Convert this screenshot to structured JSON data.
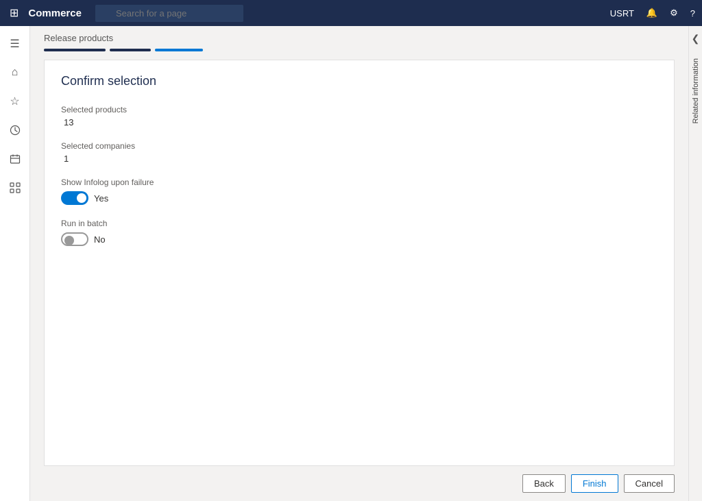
{
  "topbar": {
    "app_title": "Commerce",
    "search_placeholder": "Search for a page",
    "user_label": "USRT"
  },
  "sidebar": {
    "icons": [
      {
        "name": "hamburger-icon",
        "glyph": "☰"
      },
      {
        "name": "home-icon",
        "glyph": "⌂"
      },
      {
        "name": "favorites-icon",
        "glyph": "★"
      },
      {
        "name": "recent-icon",
        "glyph": "🕐"
      },
      {
        "name": "calendar-icon",
        "glyph": "📅"
      },
      {
        "name": "modules-icon",
        "glyph": "⊞"
      }
    ]
  },
  "page": {
    "breadcrumb": "Release products",
    "wizard_title": "Confirm selection",
    "steps": [
      {
        "type": "completed"
      },
      {
        "type": "completed"
      },
      {
        "type": "active"
      }
    ],
    "fields": {
      "selected_products_label": "Selected products",
      "selected_products_value": "13",
      "selected_companies_label": "Selected companies",
      "selected_companies_value": "1",
      "show_infolog_label": "Show Infolog upon failure",
      "show_infolog_value": true,
      "show_infolog_text": "Yes",
      "run_in_batch_label": "Run in batch",
      "run_in_batch_value": false,
      "run_in_batch_text": "No"
    },
    "buttons": {
      "back_label": "Back",
      "finish_label": "Finish",
      "cancel_label": "Cancel"
    },
    "right_panel_label": "Related information",
    "collapse_arrow": "❮"
  }
}
